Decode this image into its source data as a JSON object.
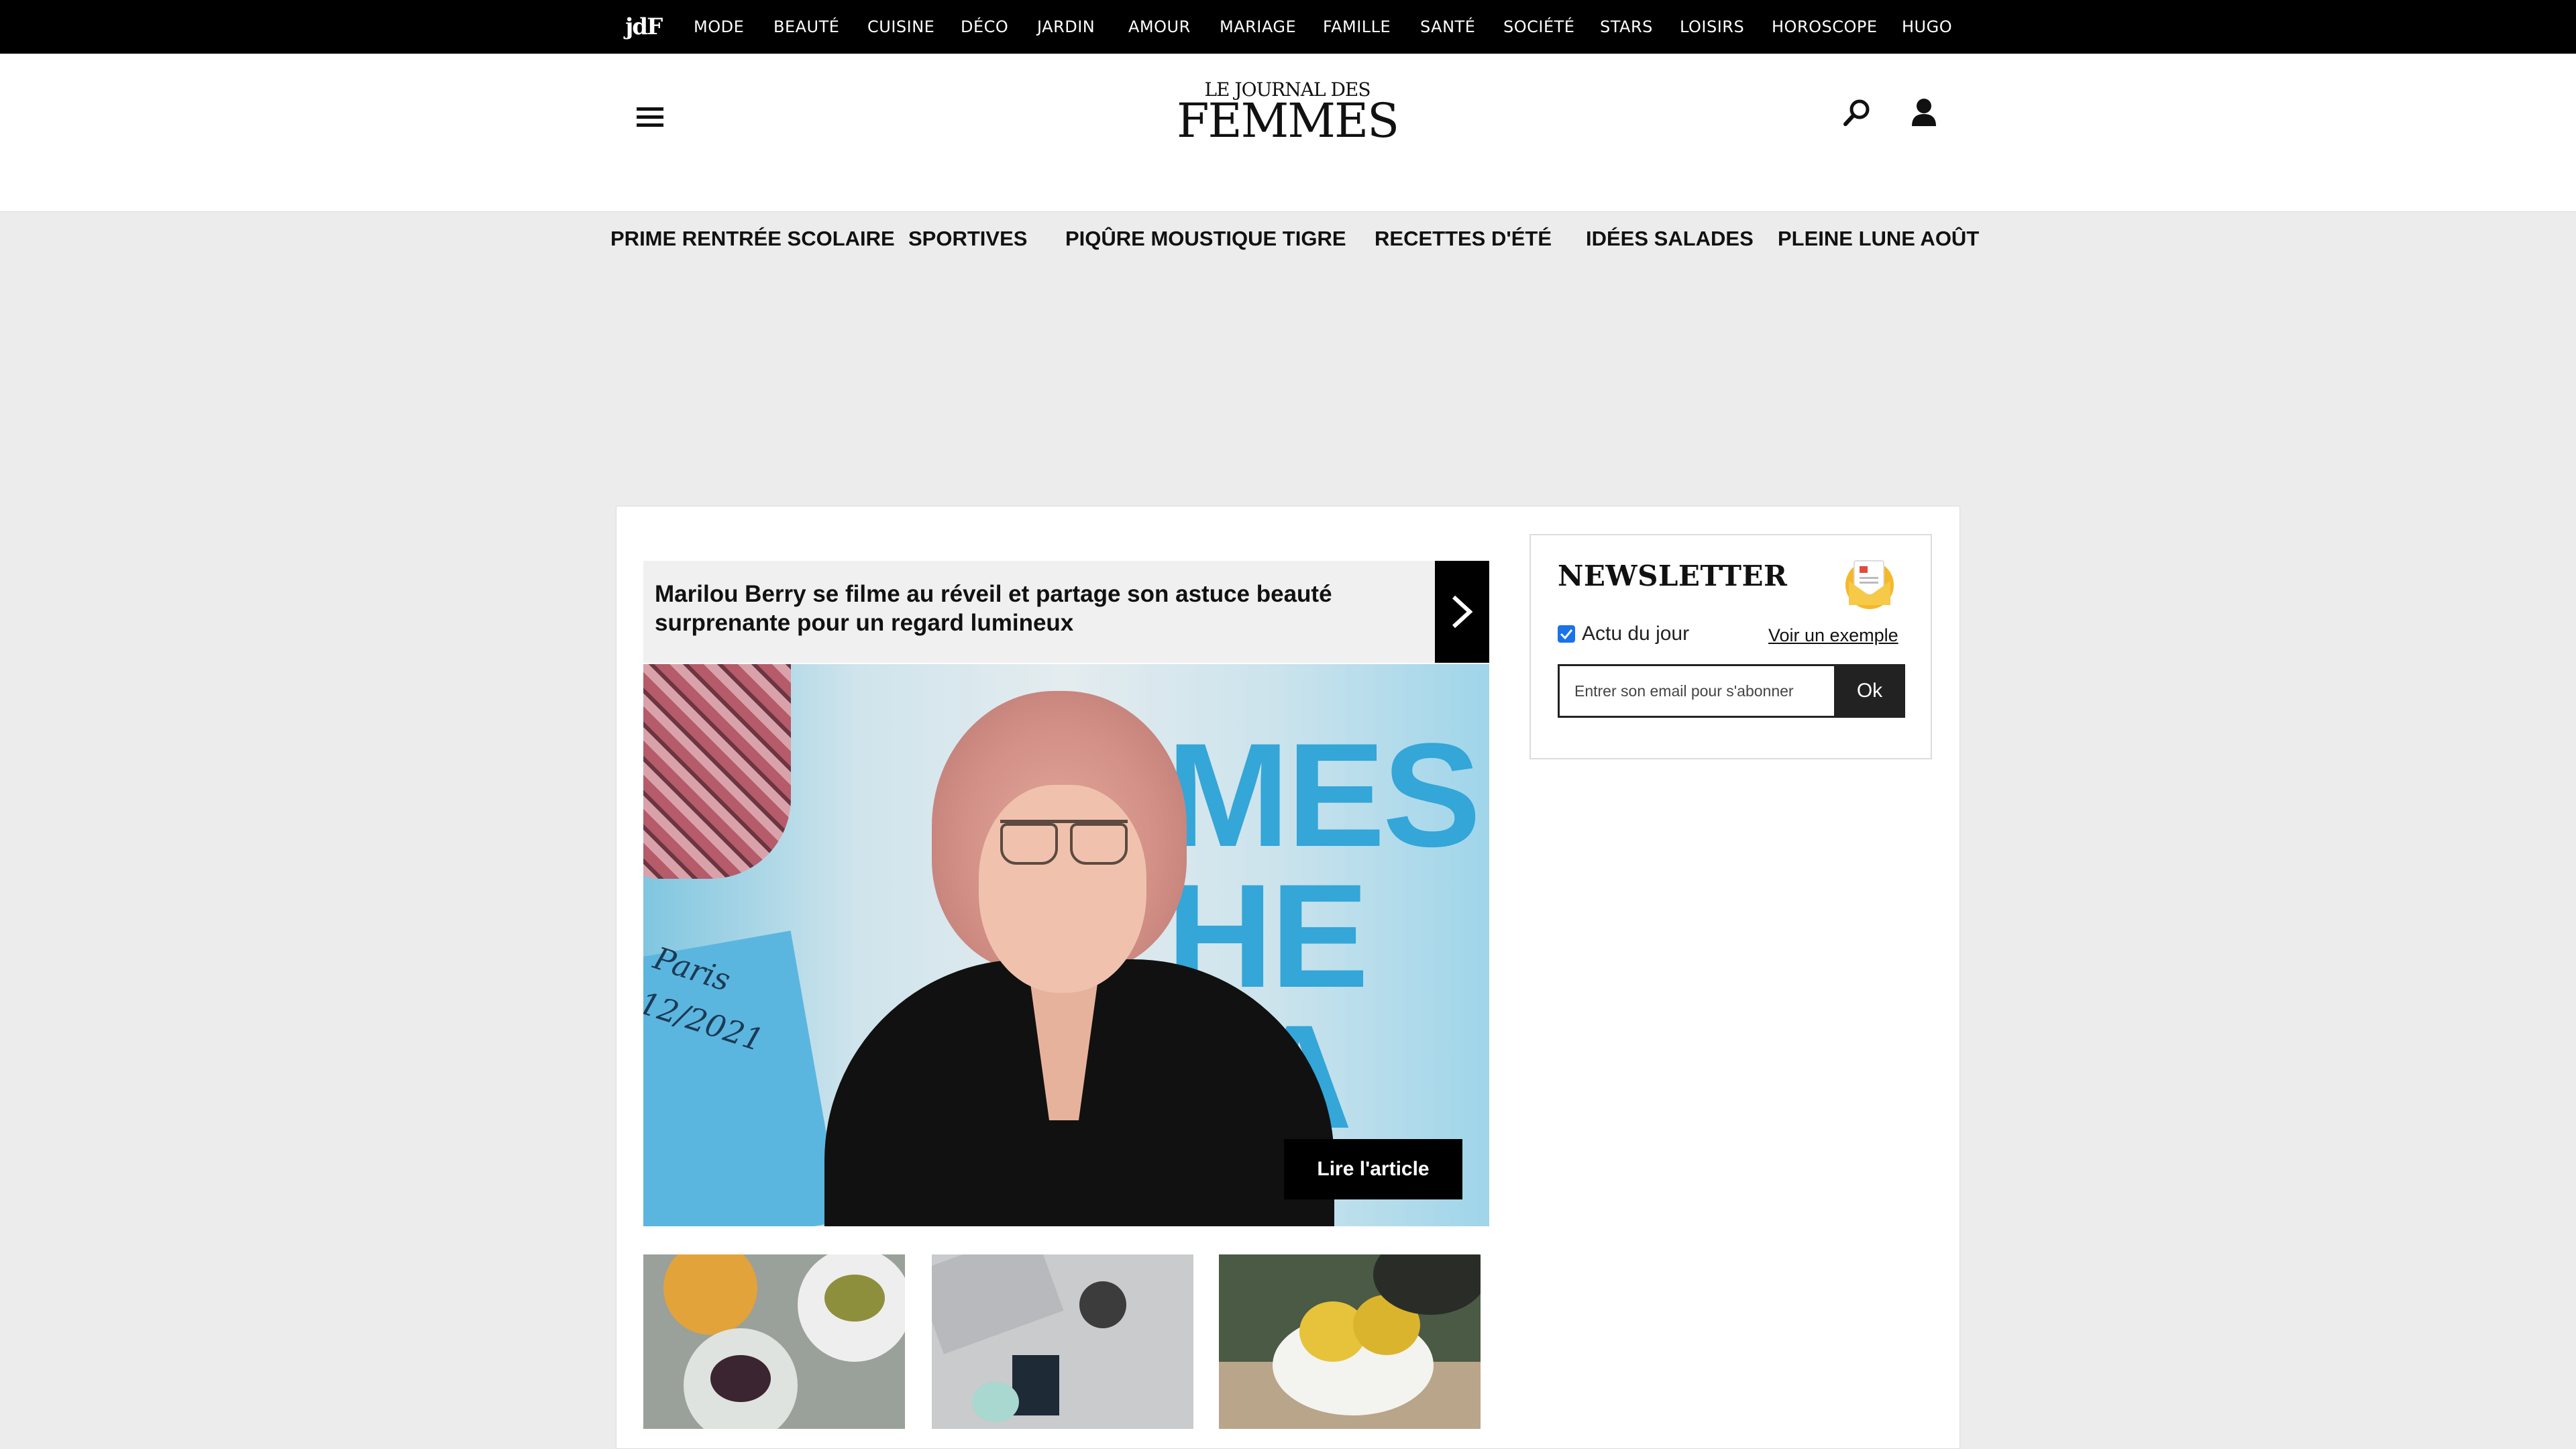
{
  "topbar": {
    "logo": "jdF",
    "items": [
      "MODE",
      "BEAUTÉ",
      "CUISINE",
      "DÉCO",
      "JARDIN",
      "AMOUR",
      "MARIAGE",
      "FAMILLE",
      "SANTÉ",
      "SOCIÉTÉ",
      "STARS",
      "LOISIRS",
      "HOROSCOPE",
      "HUGO"
    ]
  },
  "header": {
    "brand_top": "LE JOURNAL DES",
    "brand_main": "FEMMES",
    "trending": [
      "PRIME RENTRÉE SCOLAIRE",
      "SPORTIVES",
      "PIQÛRE MOUSTIQUE TIGRE",
      "RECETTES D'ÉTÉ",
      "IDÉES SALADES",
      "PLEINE LUNE AOÛT"
    ]
  },
  "featured": {
    "headline": "Marilou Berry se filme au réveil et partage son astuce beauté surprenante pour un regard lumineux",
    "read_button": "Lire l'article",
    "image_text": "MES T\nHE\nFA",
    "poster_text": "Paris\n12/2021"
  },
  "newsletter": {
    "title": "NEWSLETTER",
    "checkbox_label": "Actu du jour",
    "checkbox_checked": true,
    "example_link": "Voir un exemple",
    "email_placeholder": "Entrer son email pour s'abonner",
    "submit": "Ok"
  }
}
